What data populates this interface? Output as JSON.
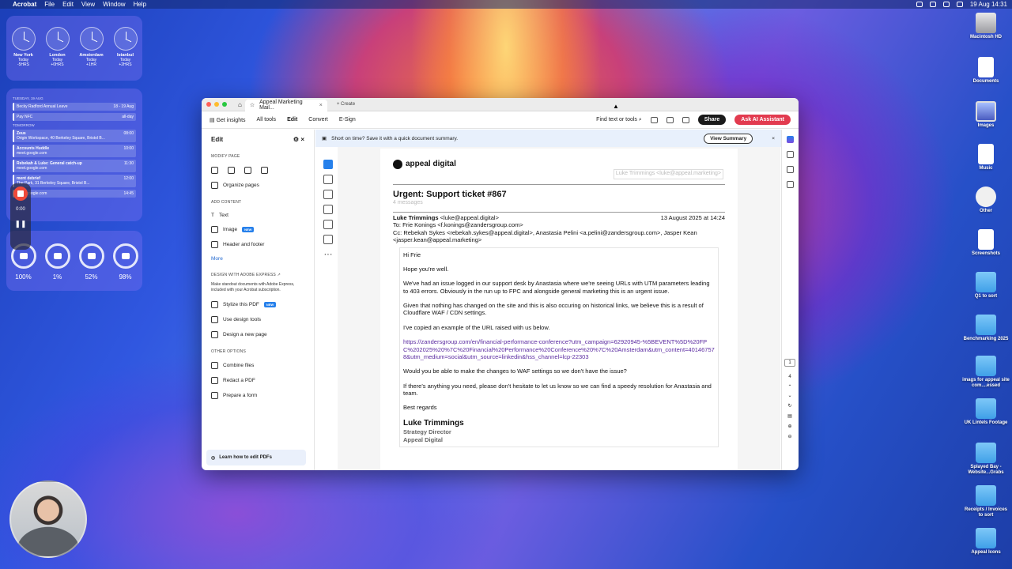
{
  "menubar": {
    "app": "Acrobat",
    "items": [
      "File",
      "Edit",
      "View",
      "Window",
      "Help"
    ],
    "datetime": "19 Aug  14:31"
  },
  "clocks": [
    {
      "city": "New York",
      "day": "Today",
      "offset": "-5HRS"
    },
    {
      "city": "London",
      "day": "Today",
      "offset": "+0HRS"
    },
    {
      "city": "Amsterdam",
      "day": "Today",
      "offset": "+1HR"
    },
    {
      "city": "Istanbul",
      "day": "Today",
      "offset": "+2HRS"
    }
  ],
  "calendar": {
    "today_header": "TUESDAY, 19 AUG",
    "tomorrow_header": "TOMORROW",
    "today": [
      {
        "title": "Becky Radford Annual Leave",
        "time": "18 - 19 Aug"
      },
      {
        "title": "Pay NFC",
        "time": "all-day"
      }
    ],
    "tomorrow": [
      {
        "title": "Zeus",
        "sub": "Origin Workspace, 40 Berkeley Square, Bristol B...",
        "time": "08:00"
      },
      {
        "title": "Accounts Huddle",
        "sub": "meet.google.com",
        "time": "10:00"
      },
      {
        "title": "Rebekah & Luke: General catch-up",
        "sub": "meet.google.com",
        "time": "11:30"
      },
      {
        "title": "ment debrief",
        "sub": "The Park, 31 Berkeley Square, Bristol B...",
        "time": "12:00"
      },
      {
        "title": "",
        "sub": "meet.google.com",
        "time": "14:45"
      }
    ]
  },
  "recorder": {
    "time": "0:00"
  },
  "battery": [
    "100%",
    "1%",
    "52%",
    "98%"
  ],
  "desktop_icons": [
    {
      "label": "Macintosh HD",
      "kind": "disk"
    },
    {
      "label": "Documents",
      "kind": "doc"
    },
    {
      "label": "Images",
      "kind": "img"
    },
    {
      "label": "Music",
      "kind": "doc"
    },
    {
      "label": "Other",
      "kind": "mail"
    },
    {
      "label": "Screenshots",
      "kind": "doc"
    },
    {
      "label": "Q1 to sort",
      "kind": "folder"
    },
    {
      "label": "Benchmarking 2025",
      "kind": "folder"
    },
    {
      "label": "imags for appeal site com....essed",
      "kind": "folder"
    },
    {
      "label": "UK Lintels Footage",
      "kind": "folder"
    },
    {
      "label": "Splayed Bay - Website...Grabs",
      "kind": "folder"
    },
    {
      "label": "Receipts / Invoices to sort",
      "kind": "folder"
    },
    {
      "label": "Appeal Icons",
      "kind": "folder"
    }
  ],
  "window": {
    "tab_title": "Appeal Marketing Mail...",
    "new_tab": "Create",
    "toolbar": {
      "get_insights": "Get insights",
      "all_tools": "All tools",
      "edit": "Edit",
      "convert": "Convert",
      "esign": "E-Sign",
      "find": "Find text or tools",
      "share": "Share",
      "ai": "Ask AI Assistant"
    },
    "panel": {
      "title": "Edit",
      "modify_page": "MODIFY PAGE",
      "organize": "Organize pages",
      "add_content": "ADD CONTENT",
      "text": "Text",
      "image": "Image",
      "new": "NEW",
      "header_footer": "Header and footer",
      "more": "More",
      "design": "DESIGN WITH ADOBE EXPRESS",
      "design_desc": "Make standout documents with Adobe Express, included with your Acrobat subscription.",
      "stylize": "Stylize this PDF",
      "design_tools": "Use design tools",
      "design_page": "Design a new page",
      "other": "OTHER OPTIONS",
      "combine": "Combine files",
      "redact": "Redact a PDF",
      "prepare": "Prepare a form",
      "learn": "Learn how to edit PDFs"
    },
    "banner": {
      "text": "Short on time? Save it with a quick document summary.",
      "button": "View Summary"
    },
    "page_nav": {
      "current": "1",
      "total": "4"
    }
  },
  "email": {
    "logo": "appeal digital",
    "from_right": "Luke Trimmings <luke@appeal.marketing>",
    "subject": "Urgent: Support ticket #867",
    "count": "4 messages",
    "sender_name": "Luke Trimmings",
    "sender_email": "<luke@appeal.digital>",
    "date": "13 August 2025 at 14:24",
    "to": "To: Frie Konings <f.konings@zandersgroup.com>",
    "cc": "Cc: Rebekah Sykes <rebekah.sykes@appeal.digital>, Anastasia Pelini <a.pelini@zandersgroup.com>, Jasper Kean <jasper.kean@appeal.marketing>",
    "greeting": "Hi Frie",
    "p1": "Hope you're well.",
    "p2": "We've had an issue logged in our support desk by Anastasia where we're seeing URLs with UTM parameters leading to 403 errors. Obviously in the run up to FPC and alongside general marketing this is an urgent issue.",
    "p3": "Given that nothing has changed on the site and this is also occuring on historical links, we believe this is a result of Cloudflare WAF / CDN settings.",
    "p4": "I've copied an example of the URL raised with us below.",
    "url": "https://zandersgroup.com/en/financial-performance-conference?utm_campaign=62920945-%5BEVENT%5D%20FPC%202025%20%7C%20Financial%20Performance%20Conference%20%7C%20Amsterdam&utm_content=401467578&utm_medium=social&utm_source=linkedin&hss_channel=lcp-22303",
    "p5": "Would you be able to make the changes to WAF settings so we don't have the issue?",
    "p6": "If there's anything you need, please don't hesitate to let us know so we can find a speedy resolution for Anastasia and team.",
    "regards": "Best regards",
    "sig_name": "Luke Trimmings",
    "sig_role": "Strategy Director",
    "sig_company": "Appeal Digital"
  }
}
